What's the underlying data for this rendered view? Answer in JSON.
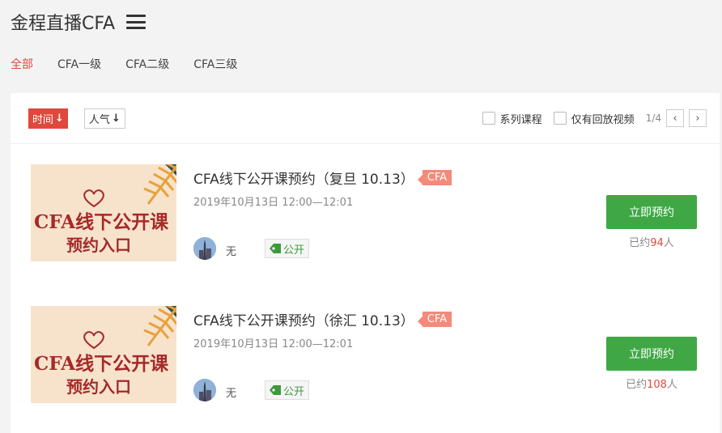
{
  "header": {
    "title": "金程直播CFA",
    "menu_icon": "hamburger-menu-icon"
  },
  "categories": [
    {
      "label": "全部",
      "active": true
    },
    {
      "label": "CFA一级",
      "active": false
    },
    {
      "label": "CFA二级",
      "active": false
    },
    {
      "label": "CFA三级",
      "active": false
    }
  ],
  "toolbar": {
    "sort_time": "时间",
    "sort_popular": "人气",
    "arrow": "↓",
    "filter_series": "系列课程",
    "filter_replay": "仅有回放视频",
    "page": "1/4",
    "prev": "‹",
    "next": "›"
  },
  "thumb_text": {
    "line1": "CFA线下公开课",
    "line2": "预约入口"
  },
  "courses": [
    {
      "title": "CFA线下公开课预约（复旦 10.13）",
      "tag": "CFA",
      "time": "2019年10月13日 12:00—12:01",
      "teacher": "无",
      "visibility": "公开",
      "button": "立即预约",
      "booked_prefix": "已约",
      "booked_count": "94",
      "booked_suffix": "人"
    },
    {
      "title": "CFA线下公开课预约（徐汇 10.13）",
      "tag": "CFA",
      "time": "2019年10月13日 12:00—12:01",
      "teacher": "无",
      "visibility": "公开",
      "button": "立即预约",
      "booked_prefix": "已约",
      "booked_count": "108",
      "booked_suffix": "人"
    }
  ],
  "colors": {
    "accent": "#e0483c",
    "button_green": "#3fa845",
    "tag_bg": "#f38a7a"
  }
}
